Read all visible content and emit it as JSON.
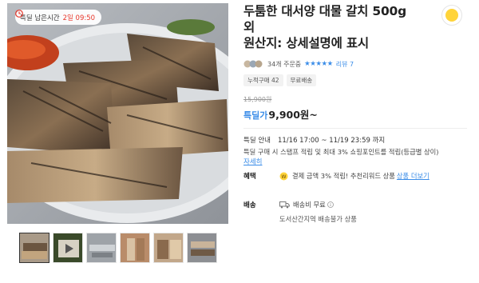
{
  "timer": {
    "label": "특딜 남은시간",
    "time": "2일 09:50"
  },
  "product": {
    "title_line1": "두툼한 대서양 대물 갈치 500g",
    "title_line2": "외",
    "title_line3": "원산지: 상세설명에 표시"
  },
  "meta": {
    "order_count": "34개 주문중",
    "stars": "★★★★★",
    "review": "리뷰 7"
  },
  "tags": [
    "누적구매 42",
    "무료배송"
  ],
  "price": {
    "original": "15,900원",
    "label": "특딜가",
    "value": "9,900원~"
  },
  "deal": {
    "label": "특딜 안내",
    "period": "11/16 17:00 ~ 11/19 23:59 까지",
    "description": "특딜 구매 시 스탬프 적립 및 최대 3% 쇼핑포인트를 적립(등급별 상이)",
    "detail_link": "자세히"
  },
  "benefit": {
    "label": "혜택",
    "text": "결제 금액 3% 적립! 추천리워드 상품",
    "more_link": "상품 더보기"
  },
  "shipping": {
    "label": "배송",
    "fee": "배송비 무료",
    "note": "도서산간지역 배송불가 상품"
  },
  "colors": {
    "accent_blue": "#3b8de8",
    "timer_red": "#e8372b",
    "badge_yellow": "#ffd43a"
  }
}
